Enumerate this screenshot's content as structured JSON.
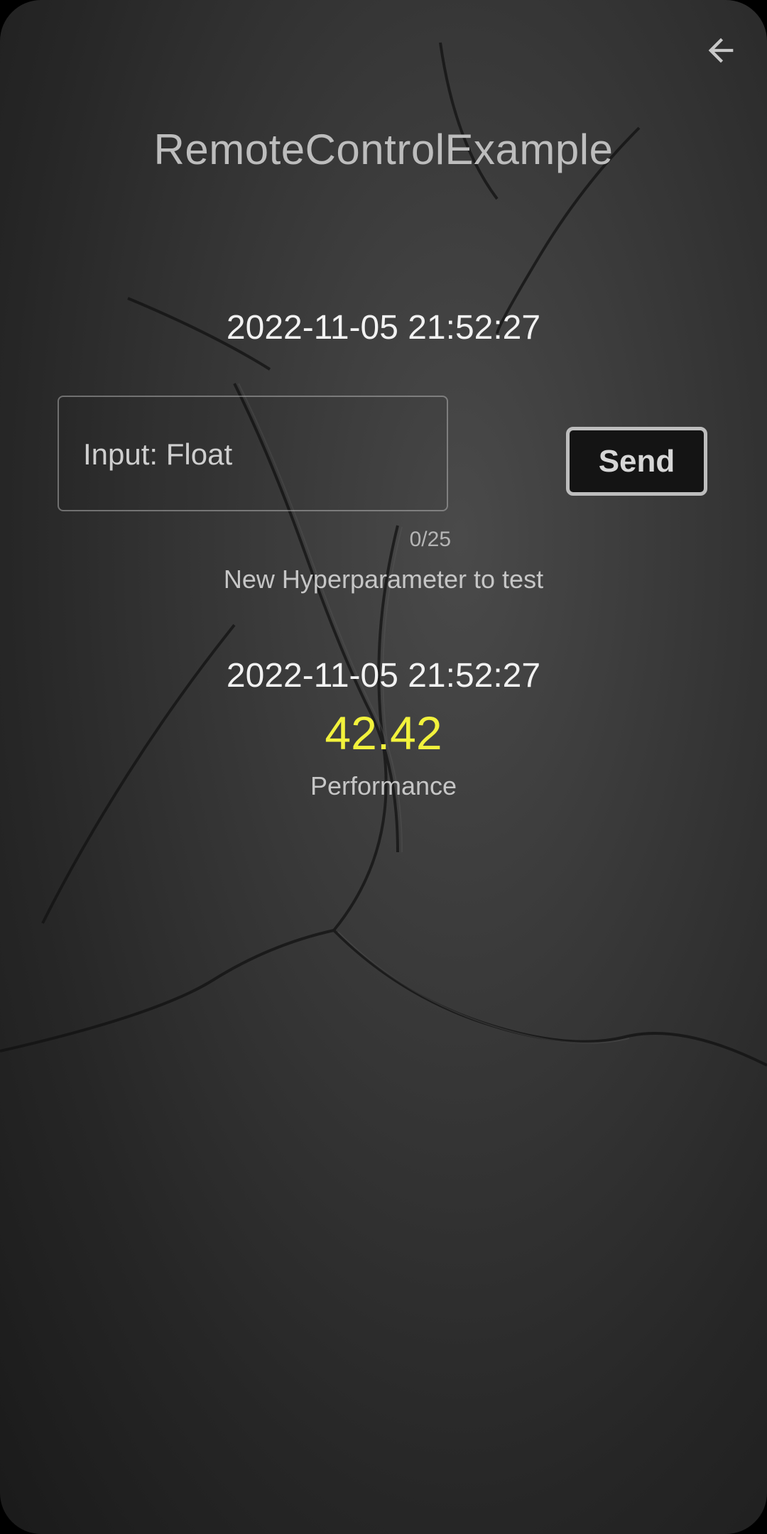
{
  "header": {
    "title": "RemoteControlExample",
    "back_icon": "arrow-left-icon"
  },
  "hyperparameter_section": {
    "timestamp": "2022-11-05 21:52:27",
    "input": {
      "value": "",
      "placeholder": "Input: Float"
    },
    "char_counter": "0/25",
    "send_label": "Send",
    "caption": "New Hyperparameter to test"
  },
  "performance_section": {
    "timestamp": "2022-11-05 21:52:27",
    "value": "42.42",
    "caption": "Performance"
  },
  "colors": {
    "performance_value": "#f2f23c",
    "background": "#2e2e2e"
  }
}
